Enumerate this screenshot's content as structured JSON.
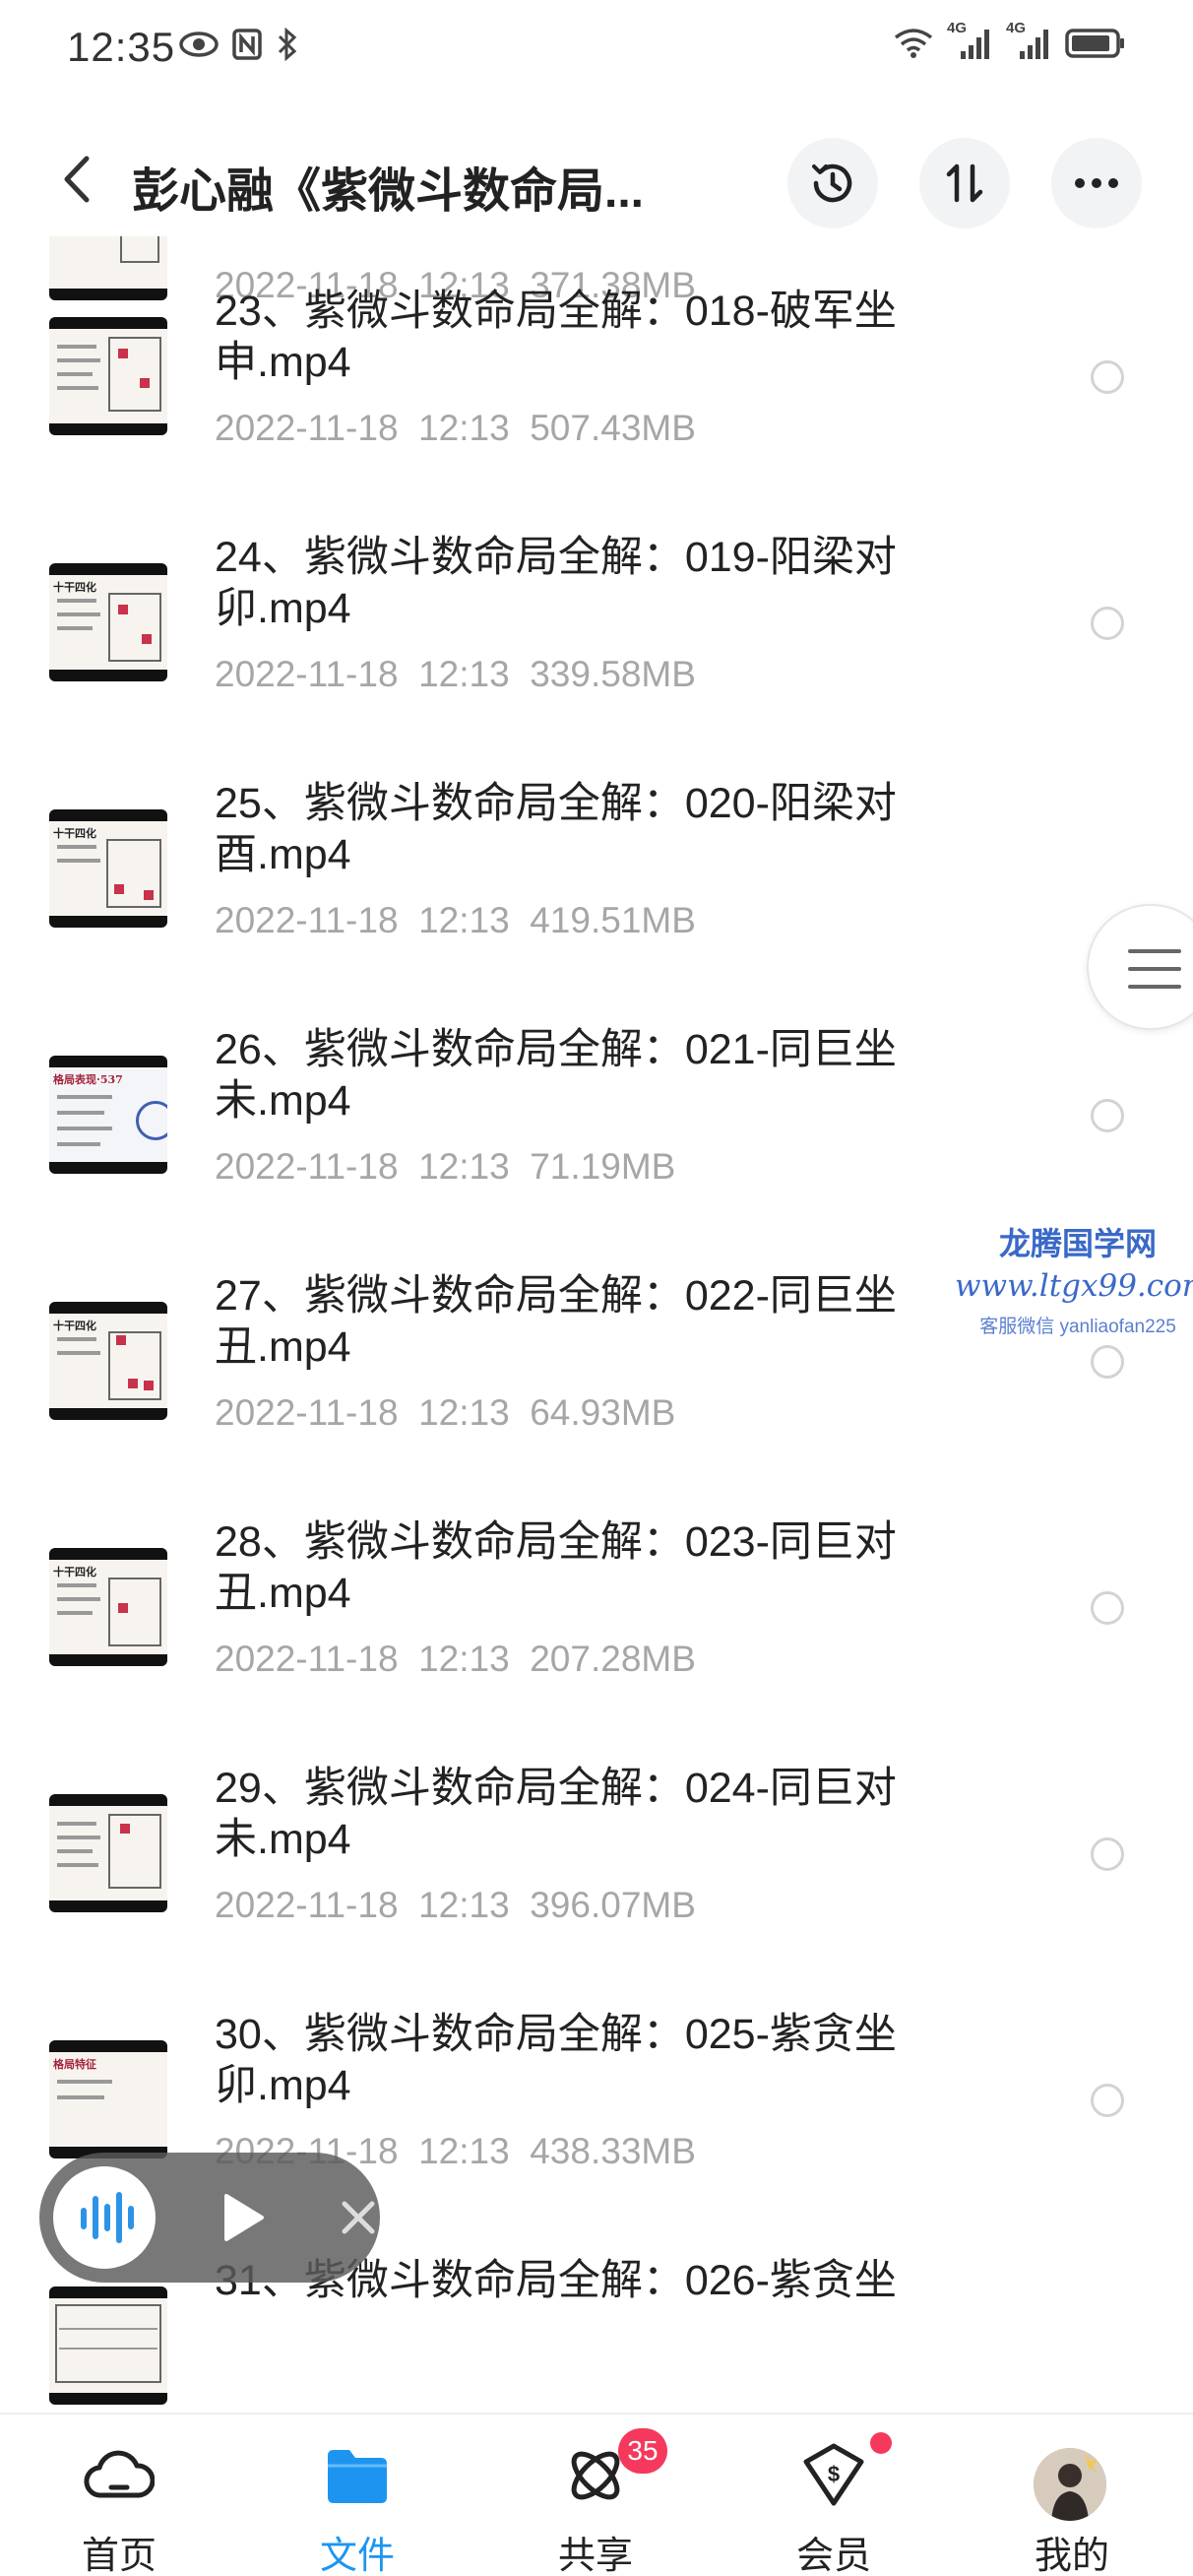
{
  "status_bar": {
    "time": "12:35",
    "left_icons": [
      "eye-icon",
      "nfc-icon",
      "bluetooth-icon"
    ],
    "right_icons": [
      "wifi-icon",
      "signal-4g-icon",
      "signal-4g-icon",
      "battery-icon"
    ],
    "network_labels": [
      "4G",
      "4G"
    ]
  },
  "header": {
    "title": "彭心融《紫微斗数命局...",
    "buttons": [
      "history-icon",
      "sort-icon",
      "more-icon"
    ]
  },
  "files": [
    {
      "name": "",
      "date": "2022-11-18  12:13",
      "size": "371.38MB"
    },
    {
      "name": "23、紫微斗数命局全解：018-破军坐申.mp4",
      "date": "2022-11-18  12:13",
      "size": "507.43MB"
    },
    {
      "name": "24、紫微斗数命局全解：019-阳梁对卯.mp4",
      "date": "2022-11-18  12:13",
      "size": "339.58MB"
    },
    {
      "name": "25、紫微斗数命局全解：020-阳梁对酉.mp4",
      "date": "2022-11-18  12:13",
      "size": "419.51MB"
    },
    {
      "name": "26、紫微斗数命局全解：021-同巨坐未.mp4",
      "date": "2022-11-18  12:13",
      "size": "71.19MB"
    },
    {
      "name": "27、紫微斗数命局全解：022-同巨坐丑.mp4",
      "date": "2022-11-18  12:13",
      "size": "64.93MB"
    },
    {
      "name": "28、紫微斗数命局全解：023-同巨对丑.mp4",
      "date": "2022-11-18  12:13",
      "size": "207.28MB"
    },
    {
      "name": "29、紫微斗数命局全解：024-同巨对未.mp4",
      "date": "2022-11-18  12:13",
      "size": "396.07MB"
    },
    {
      "name": "30、紫微斗数命局全解：025-紫贪坐卯.mp4",
      "date": "2022-11-18  12:13",
      "size": "438.33MB"
    },
    {
      "name": "31、紫微斗数命局全解：026-紫贪坐",
      "date": "",
      "size": ""
    }
  ],
  "thumb_headings": [
    "",
    "",
    "十干四化",
    "十干四化",
    "格局表现·537",
    "十干四化",
    "十干四化",
    "",
    "格局特征",
    ""
  ],
  "watermark": {
    "title": "龙腾国学网",
    "url": "www.ltgx99.com",
    "note": "客服微信 yanliaofan225"
  },
  "tabbar": {
    "tabs": [
      {
        "label": "首页",
        "icon": "cloud-home-icon"
      },
      {
        "label": "文件",
        "icon": "folder-icon",
        "active": true
      },
      {
        "label": "共享",
        "icon": "share-atom-icon"
      },
      {
        "label": "会员",
        "icon": "vip-shield-icon"
      },
      {
        "label": "我的",
        "icon": "avatar"
      }
    ],
    "share_badge": "35"
  },
  "colors": {
    "accent": "#1d95f0",
    "badge": "#f5395d",
    "meta_text": "#a6a6a6"
  }
}
